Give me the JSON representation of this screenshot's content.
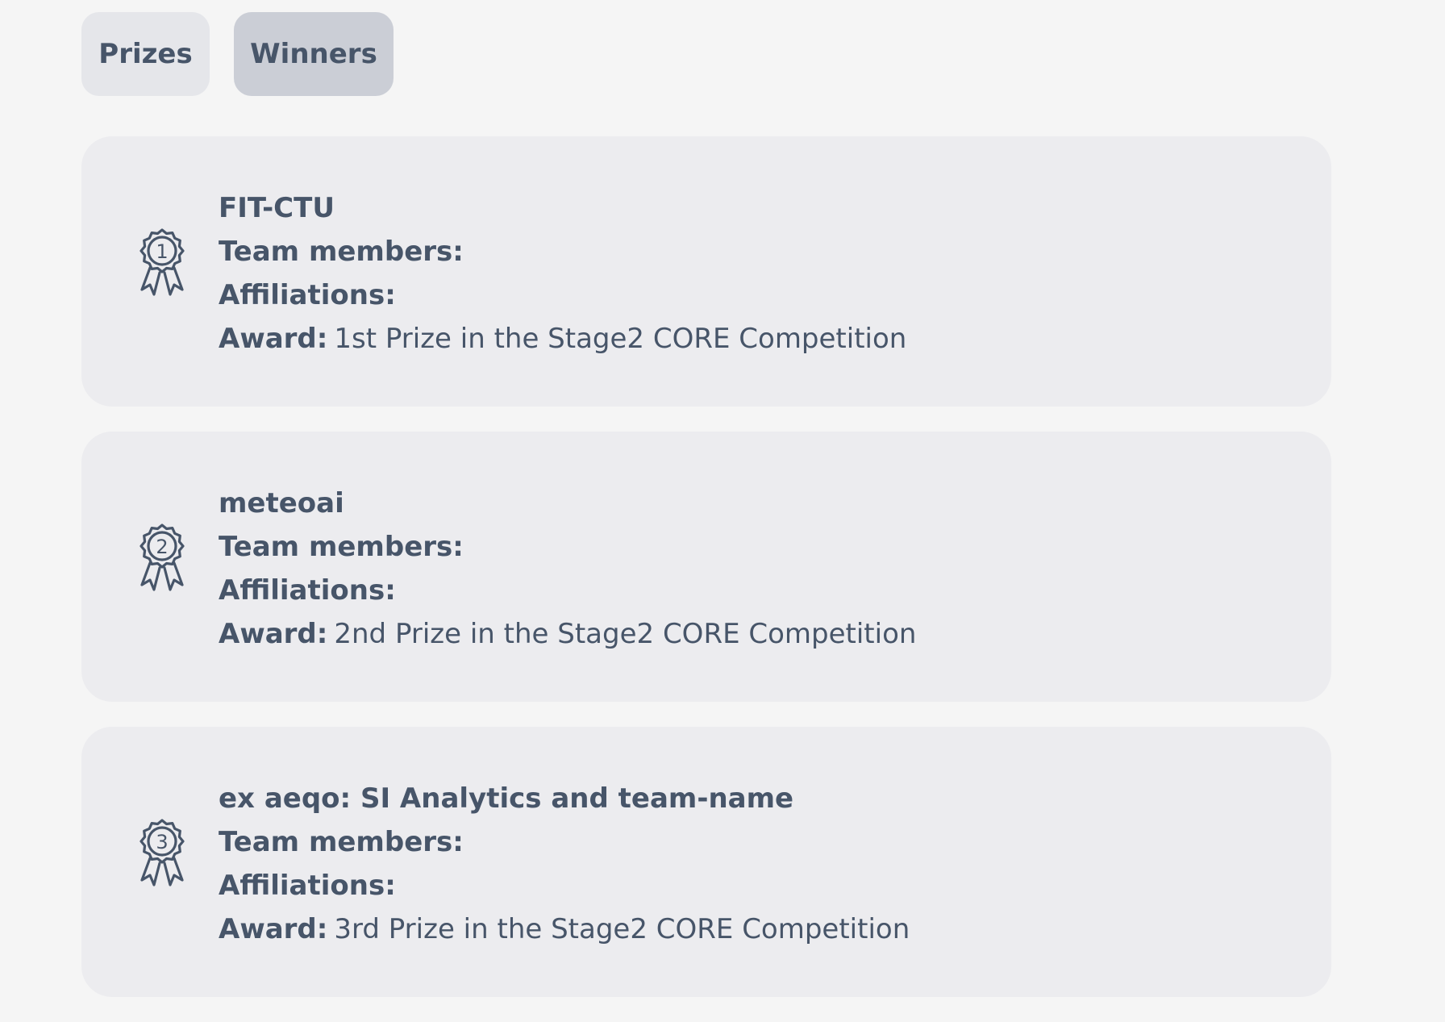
{
  "tabs": {
    "prizes": "Prizes",
    "winners": "Winners"
  },
  "labels": {
    "team_members": "Team members:",
    "affiliations": "Affiliations:",
    "award": "Award:"
  },
  "winners": [
    {
      "rank": "1",
      "team": "FIT-CTU",
      "team_members": "",
      "affiliations": "",
      "award": "1st Prize in the Stage2 CORE Competition"
    },
    {
      "rank": "2",
      "team": "meteoai",
      "team_members": "",
      "affiliations": "",
      "award": "2nd Prize in the Stage2 CORE Competition"
    },
    {
      "rank": "3",
      "team": "ex aeqo: SI Analytics and team-name",
      "team_members": "",
      "affiliations": "",
      "award": "3rd Prize in the Stage2 CORE Competition"
    }
  ],
  "icons": {
    "medal": "medal-ribbon-icon"
  },
  "colors": {
    "background": "#f5f5f5",
    "card": "#ececef",
    "tab_inactive": "#e5e6ea",
    "tab_active": "#cbced6",
    "text": "#475569"
  }
}
